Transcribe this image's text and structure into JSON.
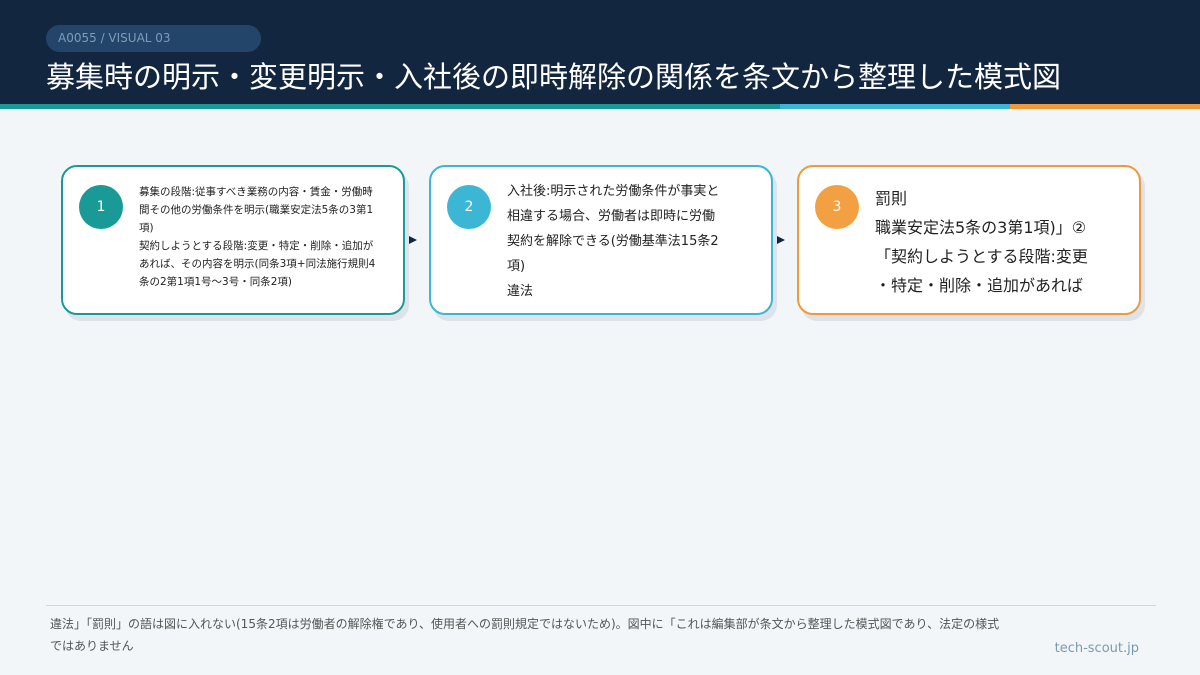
{
  "header": {
    "tag": "A0055 / VISUAL 03",
    "title": "募集時の明示・変更明示・入社後の即時解除の関係を条文から整理した模式図"
  },
  "steps": [
    {
      "number": "1",
      "lines": [
        "募集の段階:従事すべき業務の内容・賃金・労働時",
        "間その他の労働条件を明示(職業安定法5条の3第1",
        "項)",
        "契約しようとする段階:変更・特定・削除・追加が",
        "あれば、その内容を明示(同条3項+同法施行規則4",
        "条の2第1項1号〜3号・同条2項)"
      ]
    },
    {
      "number": "2",
      "lines": [
        "入社後:明示された労働条件が事実と",
        "相違する場合、労働者は即時に労働",
        "契約を解除できる(労働基準法15条2",
        "項)",
        "違法"
      ]
    },
    {
      "number": "3",
      "lines": [
        "罰則",
        "職業安定法5条の3第1項)」②",
        "「契約しようとする段階:変更",
        "・特定・削除・追加があれば"
      ]
    }
  ],
  "footer": {
    "note": "違法」「罰則」の語は図に入れない(15条2項は労働者の解除権であり、使用者への罰則規定ではないため)。図中に「これは編集部が条文から整理した模式図であり、法定の様式ではありません",
    "site": "tech-scout.jp"
  },
  "colors": {
    "header_bg": "#132640",
    "step1": "#1a9a96",
    "step2": "#3bb6d4",
    "step3": "#ee9a3d"
  }
}
